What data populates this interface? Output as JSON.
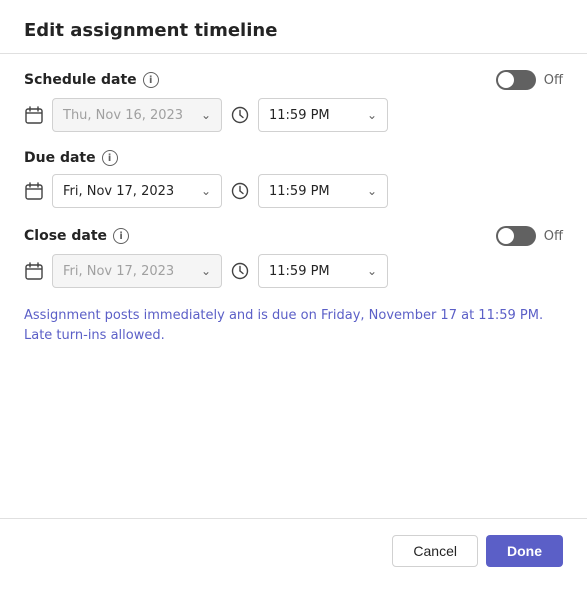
{
  "dialog": {
    "title": "Edit assignment timeline",
    "sections": {
      "schedule": {
        "label": "Schedule date",
        "toggle_state": "off",
        "toggle_label": "Off",
        "date_value": "Thu, Nov 16, 2023",
        "date_disabled": true,
        "time_value": "11:59 PM"
      },
      "due": {
        "label": "Due date",
        "date_value": "Fri, Nov 17, 2023",
        "date_disabled": false,
        "time_value": "11:59 PM"
      },
      "close": {
        "label": "Close date",
        "toggle_state": "off",
        "toggle_label": "Off",
        "date_value": "Fri, Nov 17, 2023",
        "date_disabled": true,
        "time_value": "11:59 PM"
      }
    },
    "summary": "Assignment posts immediately and is due on Friday, November 17 at 11:59 PM. Late turn-ins allowed.",
    "buttons": {
      "cancel": "Cancel",
      "done": "Done"
    }
  }
}
